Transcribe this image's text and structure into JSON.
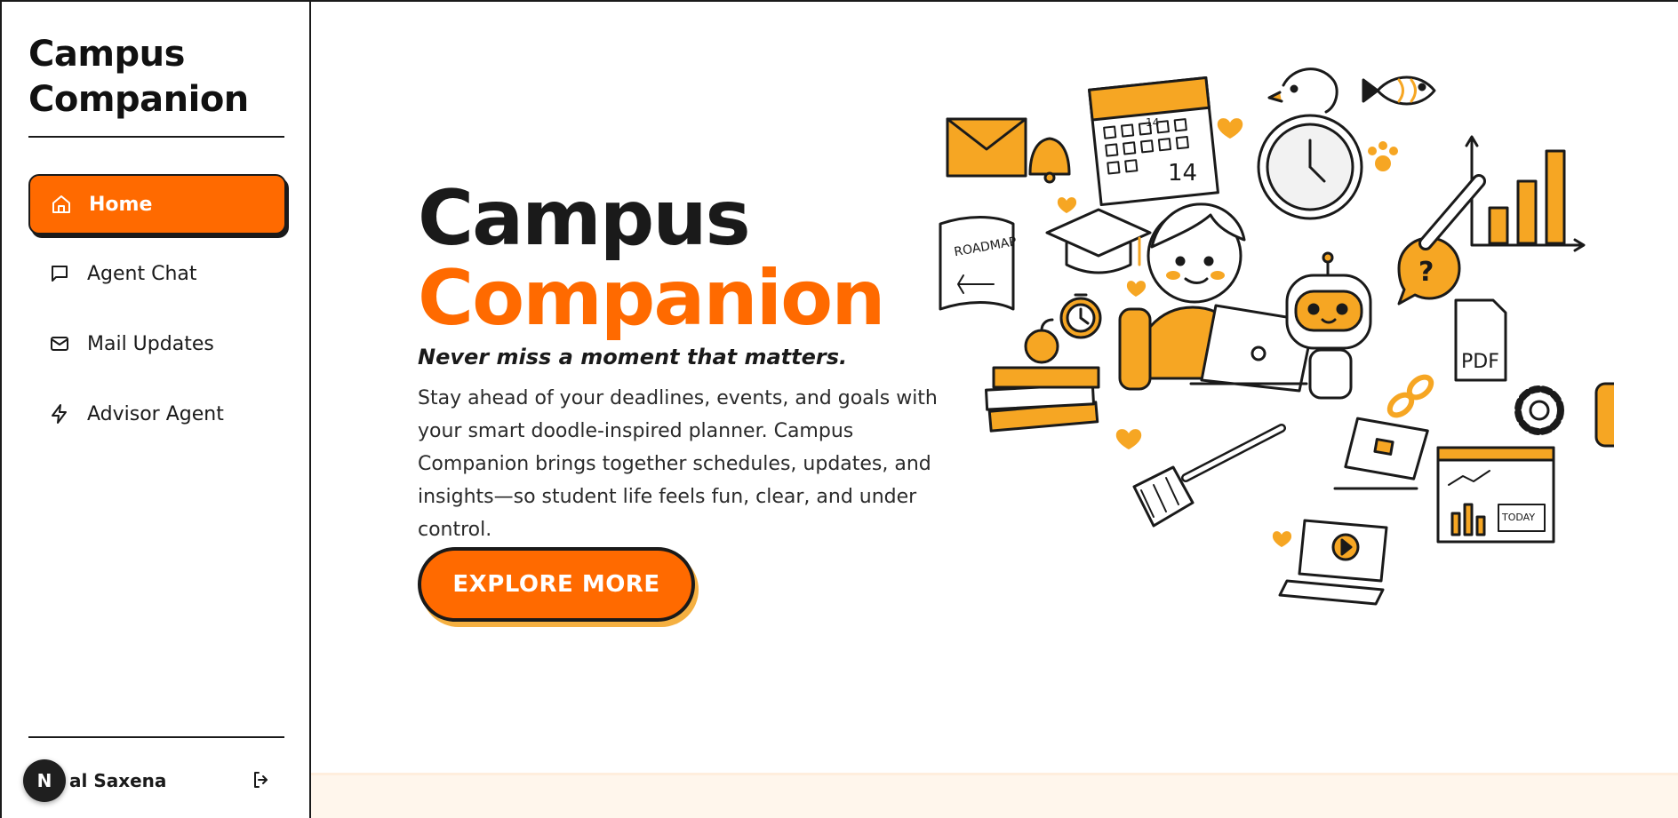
{
  "sidebar": {
    "brand_line1": "Campus",
    "brand_line2": "Companion",
    "items": [
      {
        "label": "Home",
        "icon": "home-icon",
        "active": true
      },
      {
        "label": "Agent Chat",
        "icon": "chat-bubble-icon",
        "active": false
      },
      {
        "label": "Mail Updates",
        "icon": "mail-icon",
        "active": false
      },
      {
        "label": "Advisor Agent",
        "icon": "lightning-icon",
        "active": false
      }
    ],
    "user": {
      "avatar_initial": "N",
      "name": "al Saxena"
    },
    "logout_icon": "logout-icon"
  },
  "hero": {
    "title_line1": "Campus",
    "title_line2": "Companion",
    "tagline": "Never miss a moment that matters.",
    "description": "Stay ahead of your deadlines, events, and goals with your smart doodle-inspired planner. Campus Companion brings together schedules, updates, and insights—so student life feels fun, clear, and under control.",
    "cta_label": "EXPLORE MORE",
    "illustration_labels": {
      "roadmap": "ROADMAP",
      "calendar_day": "14",
      "calendar_small": "14",
      "pdf": "PDF",
      "today": "TODAY",
      "question": "?"
    }
  },
  "colors": {
    "accent": "#ff6a00",
    "accent_shadow": "#f5b041",
    "ink": "#1a1a1a",
    "band": "#fff6ec"
  }
}
